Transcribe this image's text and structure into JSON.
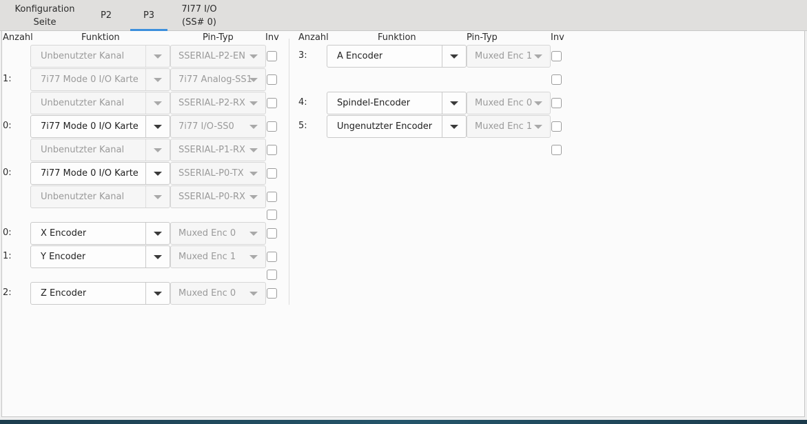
{
  "tabs": [
    {
      "line1": "Konfiguration",
      "line2": "Seite"
    },
    {
      "line1": "P2",
      "line2": ""
    },
    {
      "line1": "P3",
      "line2": ""
    },
    {
      "line1": "7I77 I/O",
      "line2": "(SS# 0)"
    }
  ],
  "active_tab": "P3",
  "headers": {
    "anzahl": "Anzahl",
    "funktion": "Funktion",
    "pintyp": "Pin-Typ",
    "inv": "Inv"
  },
  "left_rows": [
    {
      "num": "",
      "funktion": "Unbenutzter Kanal",
      "funktion_enabled": false,
      "pintyp": "SSERIAL-P2-EN"
    },
    {
      "num": "1:",
      "funktion": "7i77 Mode 0 I/O Karte",
      "funktion_enabled": false,
      "pintyp": "7i77 Analog-SS1"
    },
    {
      "num": "",
      "funktion": "Unbenutzter Kanal",
      "funktion_enabled": false,
      "pintyp": "SSERIAL-P2-RX"
    },
    {
      "num": "0:",
      "funktion": "7i77 Mode 0 I/O Karte",
      "funktion_enabled": true,
      "pintyp": "7i77 I/O-SS0"
    },
    {
      "num": "",
      "funktion": "Unbenutzter Kanal",
      "funktion_enabled": false,
      "pintyp": "SSERIAL-P1-RX"
    },
    {
      "num": "0:",
      "funktion": "7i77 Mode 0 I/O Karte",
      "funktion_enabled": true,
      "pintyp": "SSERIAL-P0-TX"
    },
    {
      "num": "",
      "funktion": "Unbenutzter Kanal",
      "funktion_enabled": false,
      "pintyp": "SSERIAL-P0-RX"
    },
    {
      "num": "0:",
      "funktion": "X Encoder",
      "funktion_enabled": true,
      "pintyp": "Muxed Enc 0"
    },
    {
      "num": "1:",
      "funktion": "Y Encoder",
      "funktion_enabled": true,
      "pintyp": "Muxed Enc 1"
    },
    {
      "num": "2:",
      "funktion": "Z Encoder",
      "funktion_enabled": true,
      "pintyp": "Muxed Enc 0"
    }
  ],
  "right_rows": [
    {
      "num": "3:",
      "funktion": "A Encoder",
      "funktion_enabled": true,
      "pintyp": "Muxed Enc 1"
    },
    {
      "num": "4:",
      "funktion": "Spindel-Encoder",
      "funktion_enabled": true,
      "pintyp": "Muxed Enc 0"
    },
    {
      "num": "5:",
      "funktion": "Ungenutzter Encoder",
      "funktion_enabled": true,
      "pintyp": "Muxed Enc 1"
    }
  ],
  "colors": {
    "accent": "#3c8fdc",
    "panel": "#fbfbfb",
    "tabbar": "#e0dfdd"
  }
}
